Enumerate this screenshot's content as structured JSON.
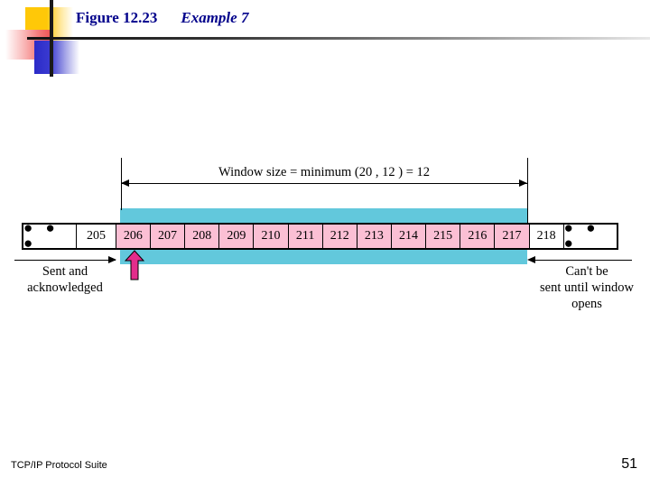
{
  "slide": {
    "title_figure": "Figure 12.23",
    "title_example": "Example 7",
    "footer_left": "TCP/IP Protocol Suite",
    "footer_page": "51"
  },
  "colors": {
    "title": "#00008B",
    "window_band": "#62C8DC",
    "in_window_cell": "#FBBFD4",
    "pointer_arrow": "#E32D8B",
    "deco_yellow": "#FFC808",
    "deco_red": "#F05050",
    "deco_blue": "#2B2BC8",
    "border": "#000000"
  },
  "diagram": {
    "window_label": "Window size = minimum (20 , 12 ) = 12",
    "sent_label_line1": "Sent and",
    "sent_label_line2": "acknowledged",
    "cant_send_line1": "Can't be",
    "cant_send_line2": "sent until window",
    "cant_send_line3": "opens",
    "ellipsis": "● ● ●",
    "pointer_icon": "up-arrow-icon",
    "cells": [
      {
        "label": "● ● ●",
        "kind": "ellipsis",
        "in_window": false
      },
      {
        "label": "205",
        "kind": "num205",
        "in_window": false
      },
      {
        "label": "206",
        "kind": "num",
        "in_window": true
      },
      {
        "label": "207",
        "kind": "num",
        "in_window": true
      },
      {
        "label": "208",
        "kind": "num",
        "in_window": true
      },
      {
        "label": "209",
        "kind": "num",
        "in_window": true
      },
      {
        "label": "210",
        "kind": "num",
        "in_window": true
      },
      {
        "label": "211",
        "kind": "num",
        "in_window": true
      },
      {
        "label": "212",
        "kind": "num",
        "in_window": true
      },
      {
        "label": "213",
        "kind": "num",
        "in_window": true
      },
      {
        "label": "214",
        "kind": "num",
        "in_window": true
      },
      {
        "label": "215",
        "kind": "num",
        "in_window": true
      },
      {
        "label": "216",
        "kind": "num",
        "in_window": true
      },
      {
        "label": "217",
        "kind": "num",
        "in_window": true
      },
      {
        "label": "218",
        "kind": "num",
        "in_window": false
      },
      {
        "label": "● ● ●",
        "kind": "ellipsis",
        "in_window": false
      }
    ]
  }
}
